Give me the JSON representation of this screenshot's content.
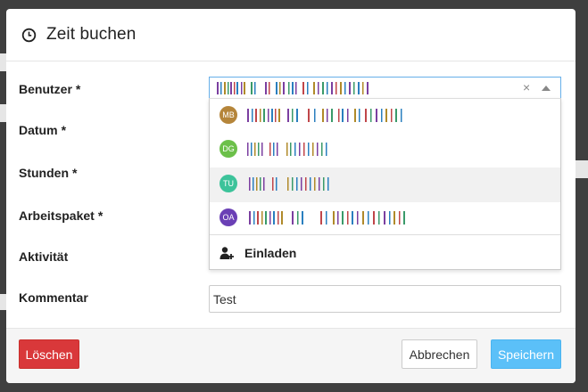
{
  "modal": {
    "title": "Zeit buchen",
    "title_icon": "clock-icon"
  },
  "form": {
    "required_marker": "*",
    "labels": {
      "user": "Benutzer",
      "date": "Datum",
      "hours": "Stunden",
      "work_package": "Arbeitspaket",
      "activity": "Aktivität",
      "comment": "Kommentar"
    },
    "user_select": {
      "clear_symbol": "×",
      "options": [
        {
          "initials": "MB",
          "color": "#b5853a",
          "highlighted": false
        },
        {
          "initials": "DG",
          "color": "#6cc04a",
          "highlighted": false
        },
        {
          "initials": "TU",
          "color": "#3cc39a",
          "highlighted": true
        },
        {
          "initials": "OA",
          "color": "#6a3fb5",
          "highlighted": false
        }
      ],
      "invite_label": "Einladen"
    },
    "comment_value": "Test"
  },
  "footer": {
    "delete_label": "Löschen",
    "cancel_label": "Abbrechen",
    "save_label": "Speichern"
  },
  "colors": {
    "delete": "#d9383a",
    "save": "#5bc0f8",
    "focus_border": "#66afe9"
  }
}
